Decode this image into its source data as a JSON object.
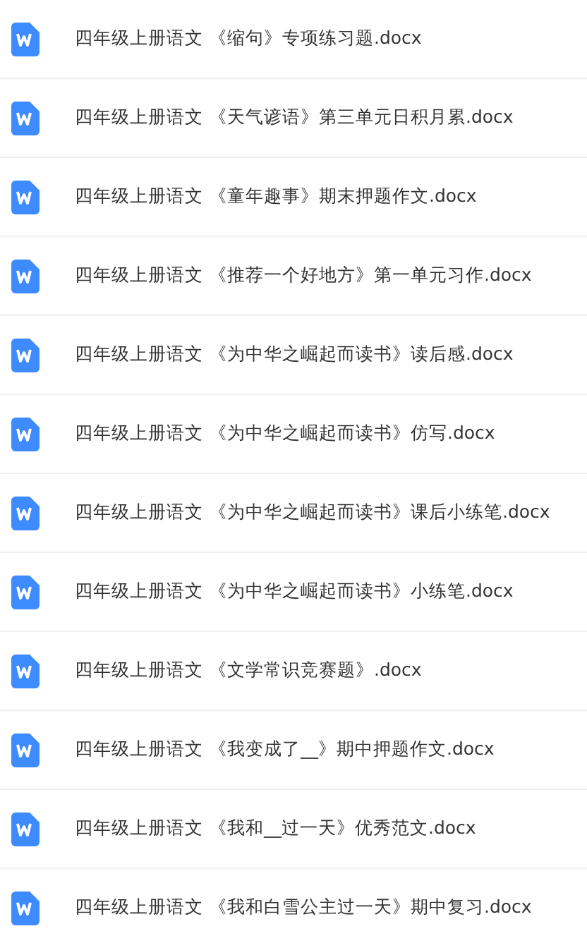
{
  "files": [
    {
      "name": "四年级上册语文 《缩句》专项练习题.docx"
    },
    {
      "name": "四年级上册语文 《天气谚语》第三单元日积月累.docx"
    },
    {
      "name": "四年级上册语文 《童年趣事》期末押题作文.docx"
    },
    {
      "name": "四年级上册语文 《推荐一个好地方》第一单元习作.docx"
    },
    {
      "name": "四年级上册语文 《为中华之崛起而读书》读后感.docx"
    },
    {
      "name": "四年级上册语文 《为中华之崛起而读书》仿写.docx"
    },
    {
      "name": "四年级上册语文 《为中华之崛起而读书》课后小练笔.docx"
    },
    {
      "name": "四年级上册语文 《为中华之崛起而读书》小练笔.docx"
    },
    {
      "name": "四年级上册语文 《文学常识竞赛题》.docx"
    },
    {
      "name": "四年级上册语文 《我变成了__》期中押题作文.docx"
    },
    {
      "name": "四年级上册语文 《我和__过一天》优秀范文.docx"
    },
    {
      "name": "四年级上册语文 《我和白雪公主过一天》期中复习.docx"
    }
  ]
}
